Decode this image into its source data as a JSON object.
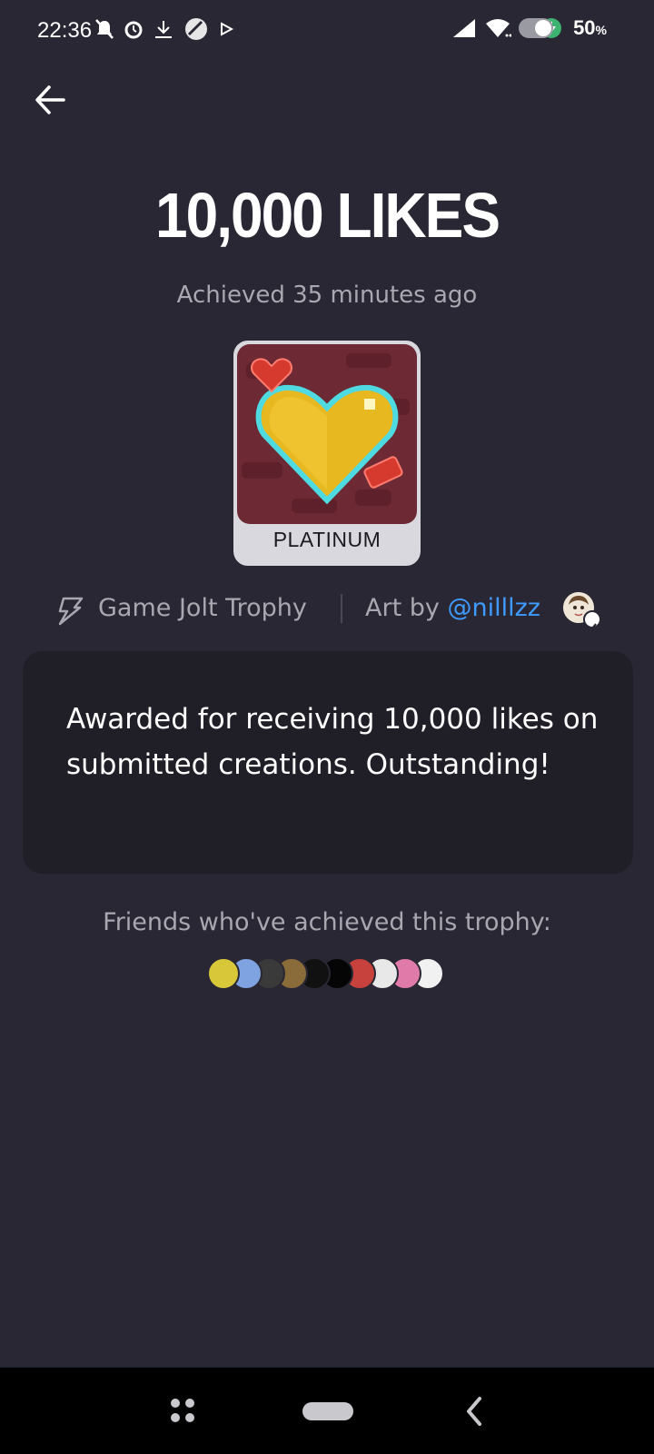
{
  "status_bar": {
    "time": "22:36",
    "battery_percent": "50",
    "battery_unit": "%",
    "icons_left": [
      "mute-icon",
      "alarm-icon",
      "download-icon",
      "vpn-icon",
      "play-icon"
    ],
    "icons_right": [
      "signal-icon",
      "wifi-icon",
      "battery-saver-icon"
    ]
  },
  "header": {
    "back_icon": "arrow-left-icon"
  },
  "trophy": {
    "title": "10,000 LIKES",
    "achieved": "Achieved 35 minutes ago",
    "tier": "PLATINUM",
    "type": "Game Jolt Trophy",
    "art_by_prefix": "Art by ",
    "artist_handle": "@nilllzz",
    "description": "Awarded for receiving 10,000 likes on submitted creations. Outstanding!"
  },
  "friends": {
    "label": "Friends who've achieved this trophy:",
    "avatars": [
      {
        "color": "#d9c73a"
      },
      {
        "color": "#7fa3e0"
      },
      {
        "color": "#3a3a3a"
      },
      {
        "color": "#8a6b3a"
      },
      {
        "color": "#111111"
      },
      {
        "color": "#050505"
      },
      {
        "color": "#c7423c"
      },
      {
        "color": "#e8e8e8"
      },
      {
        "color": "#e07aa8"
      },
      {
        "color": "#f1f1f1"
      }
    ]
  },
  "colors": {
    "background": "#292733",
    "card": "#201f28",
    "link": "#3f9bff",
    "muted_text": "#a9a7b0",
    "tier_badge": "#d8d8de"
  },
  "nav_bar": {
    "icons": [
      "recents-icon",
      "home-pill-icon",
      "back-chevron-icon"
    ]
  }
}
